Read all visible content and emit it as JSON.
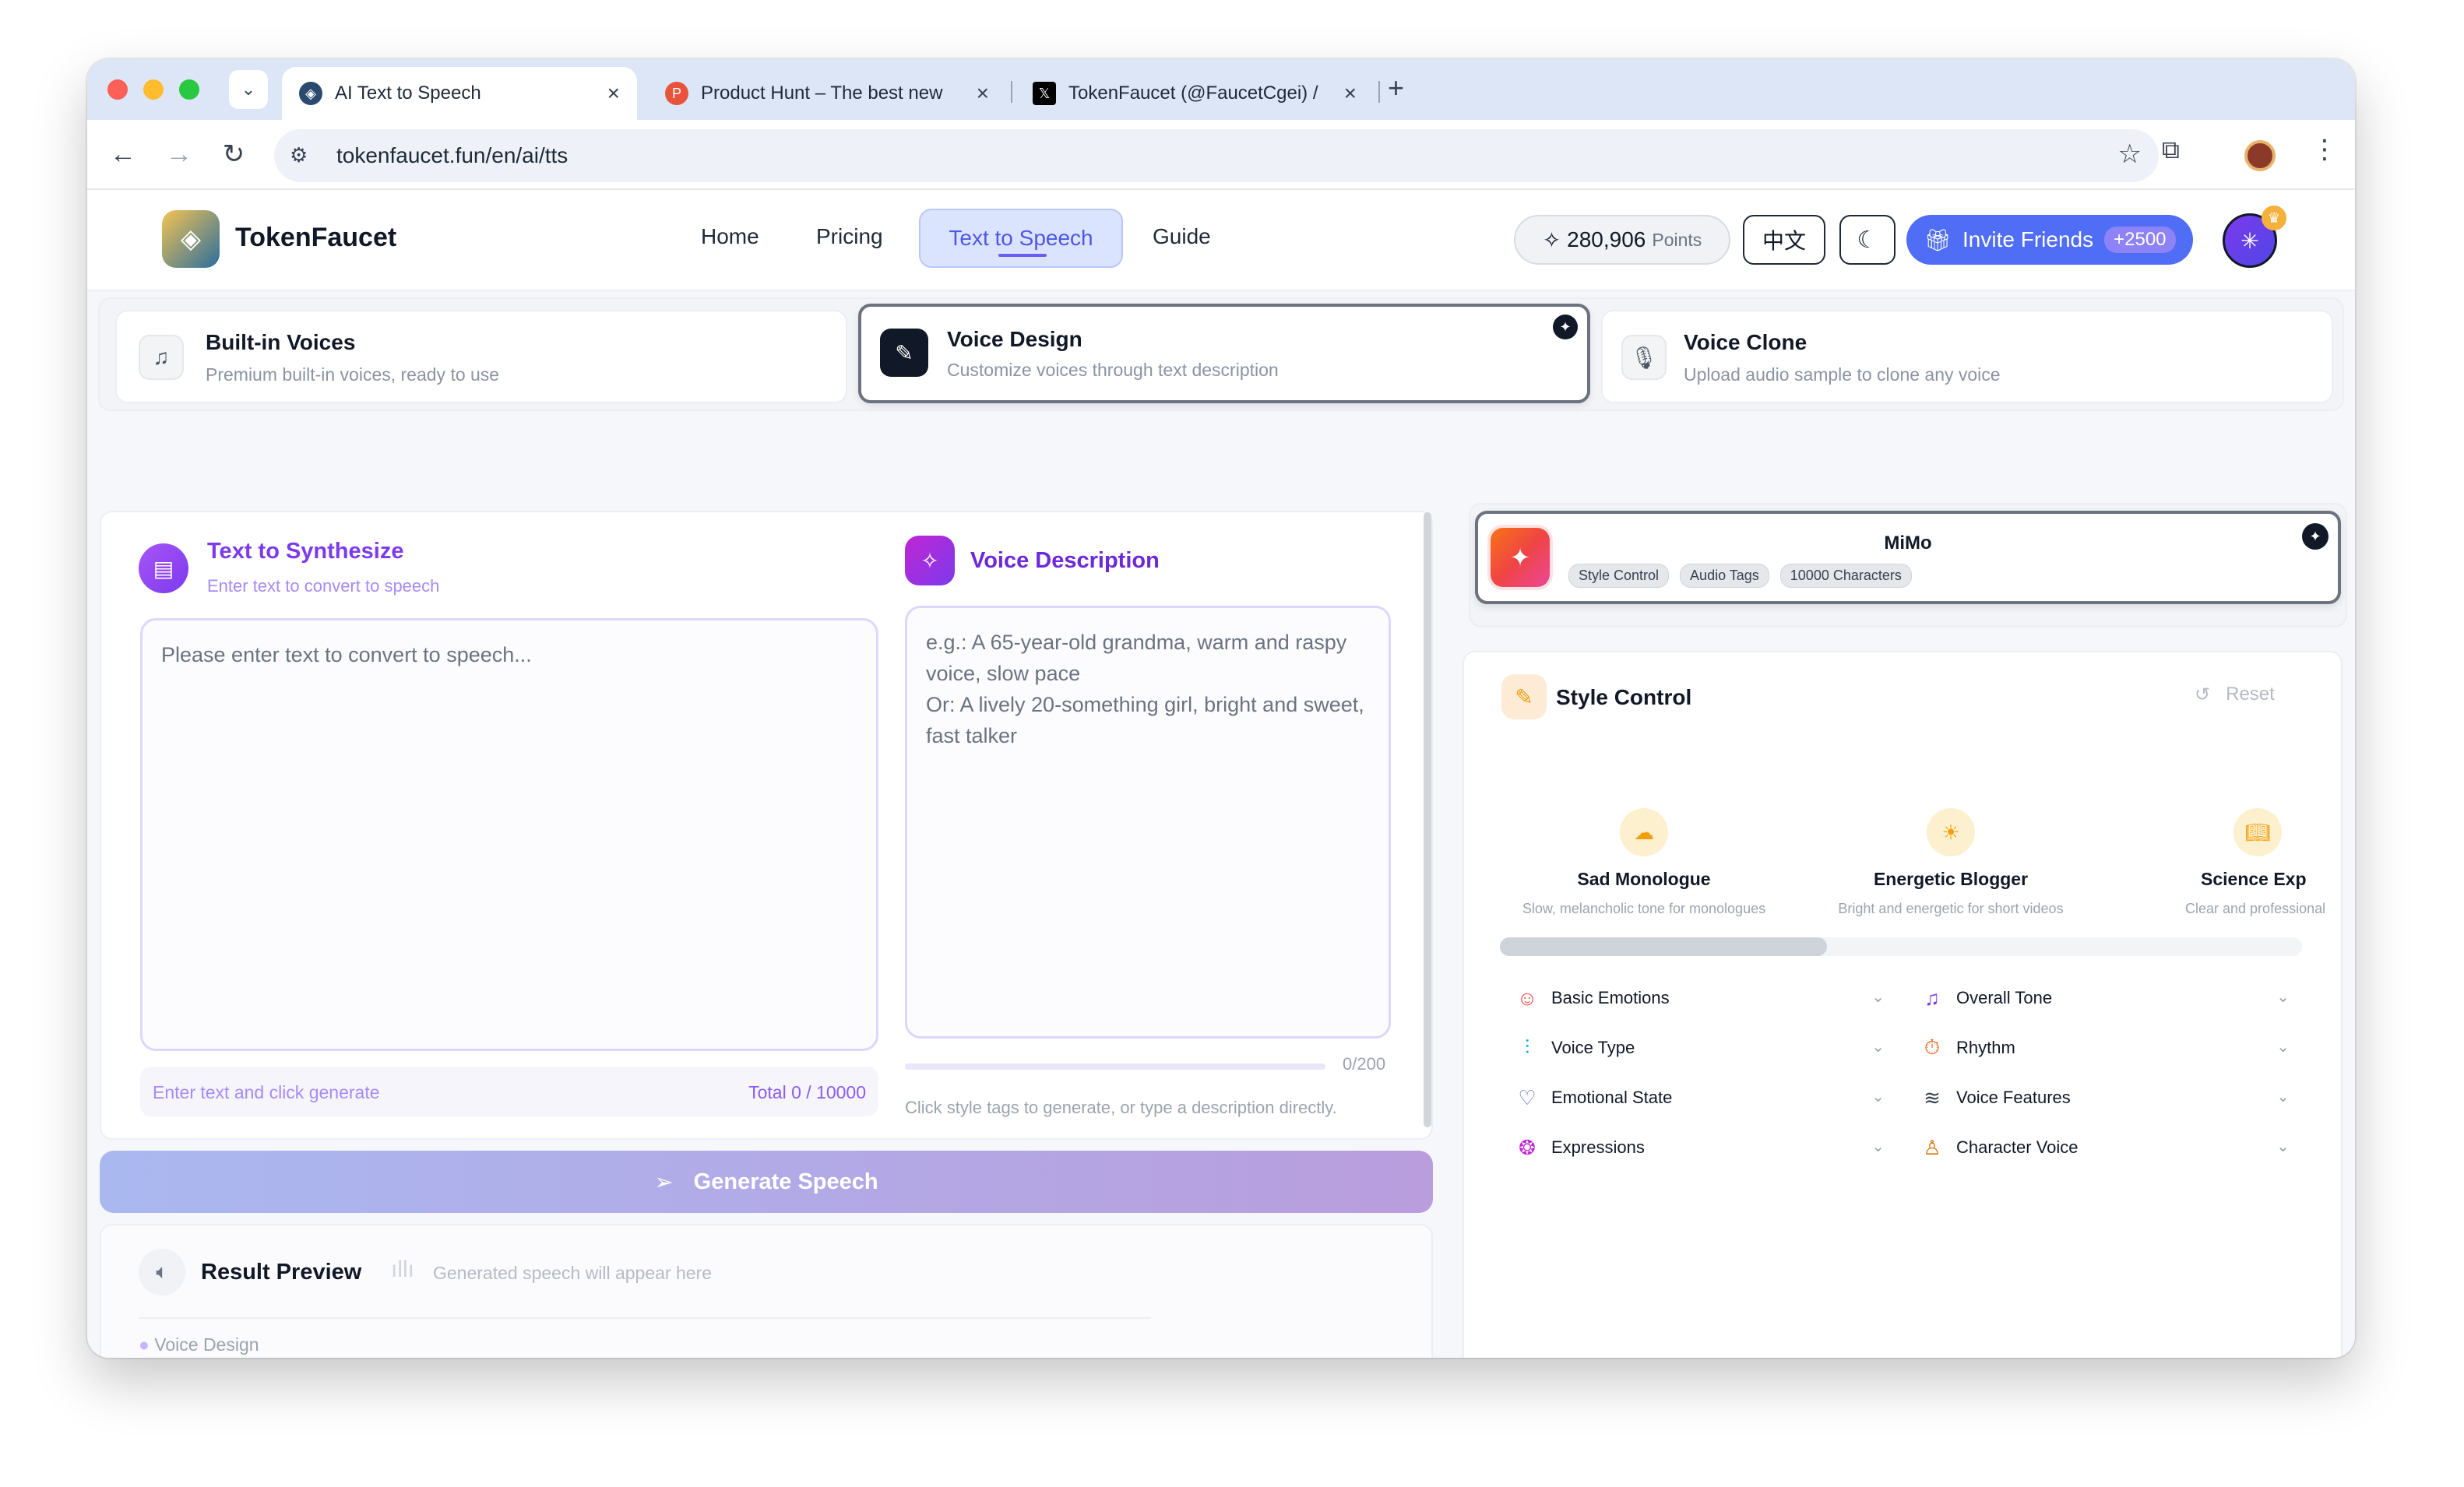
{
  "browser": {
    "tabs": [
      {
        "title": "AI Text to Speech",
        "active": true
      },
      {
        "title": "Product Hunt – The best new",
        "active": false
      },
      {
        "title": "TokenFaucet (@FaucetCgei) /",
        "active": false
      }
    ],
    "url": "tokenfaucet.fun/en/ai/tts"
  },
  "header": {
    "brand": "TokenFaucet",
    "nav": [
      "Home",
      "Pricing",
      "Text to Speech",
      "Guide"
    ],
    "points_value": "280,906",
    "points_label": "Points",
    "lang": "中文",
    "invite_label": "Invite Friends",
    "invite_bonus": "+2500"
  },
  "modes": [
    {
      "title": "Built-in Voices",
      "subtitle": "Premium built-in voices, ready to use"
    },
    {
      "title": "Voice Design",
      "subtitle": "Customize voices through text description"
    },
    {
      "title": "Voice Clone",
      "subtitle": "Upload audio sample to clone any voice"
    }
  ],
  "synth": {
    "title": "Text to Synthesize",
    "subtitle": "Enter text to convert to speech",
    "placeholder": "Please enter text to convert to speech...",
    "hint": "Enter text and click generate",
    "total": "Total 0 / 10000"
  },
  "voice_desc": {
    "title": "Voice Description",
    "placeholder": "e.g.: A 65-year-old grandma, warm and raspy voice, slow pace\nOr: A lively 20-something girl, bright and sweet, fast talker",
    "count": "0/200",
    "hint": "Click style tags to generate, or type a description directly."
  },
  "generate_label": "Generate Speech",
  "result": {
    "title": "Result Preview",
    "placeholder": "Generated speech will appear here",
    "mode": "Voice Design"
  },
  "model": {
    "name": "MiMo",
    "tags": [
      "Style Control",
      "Audio Tags",
      "10000 Characters"
    ]
  },
  "style_control": {
    "title": "Style Control",
    "reset": "Reset",
    "presets": [
      {
        "name": "Sad Monologue",
        "desc": "Slow, melancholic tone for monologues"
      },
      {
        "name": "Energetic Blogger",
        "desc": "Bright and energetic for short videos"
      },
      {
        "name": "Science Exp",
        "desc": "Clear and professional fo"
      }
    ],
    "categories_left": [
      "Basic Emotions",
      "Voice Type",
      "Emotional State",
      "Expressions"
    ],
    "categories_right": [
      "Overall Tone",
      "Rhythm",
      "Voice Features",
      "Character Voice"
    ]
  },
  "colors": {
    "accent": "#7c3aed",
    "active_nav_bg": "#dbe4ff",
    "invite": "#4f6df5",
    "generate": "#b3b5ec",
    "preset_icon": "#f59e0b"
  }
}
